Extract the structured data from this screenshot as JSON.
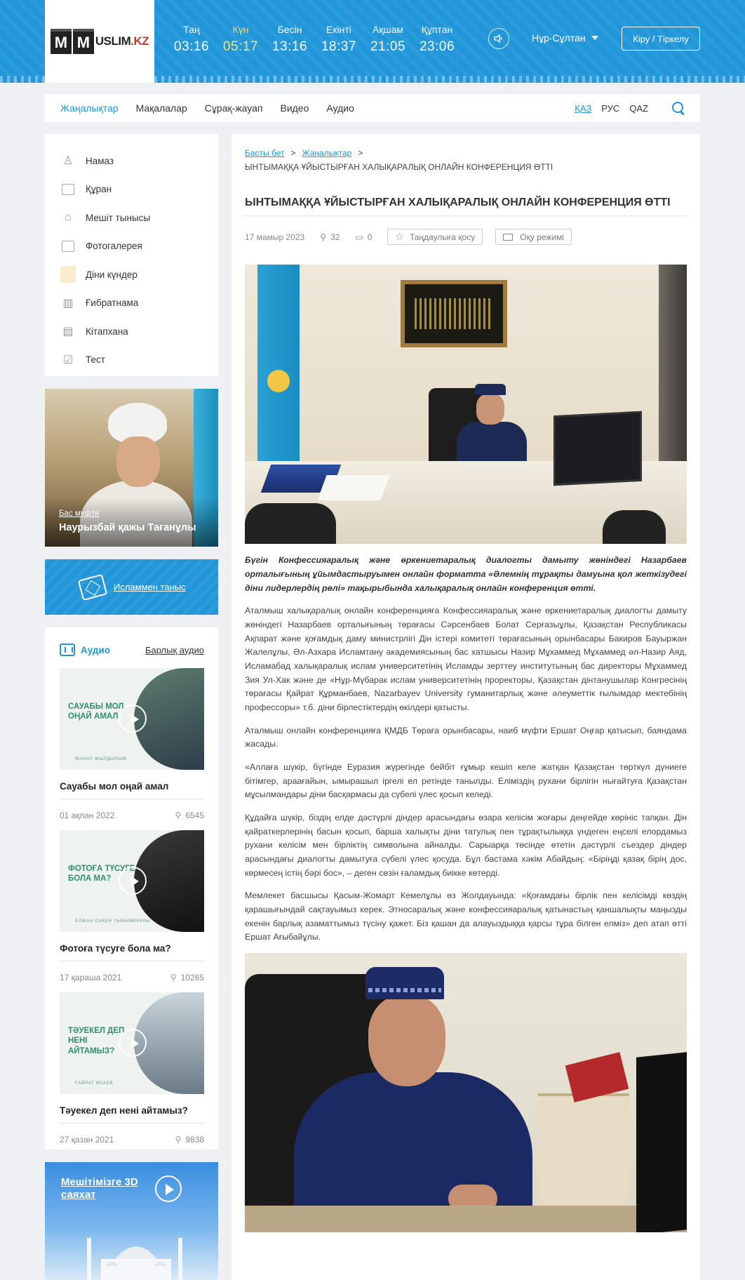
{
  "header": {
    "logo_text_a": "USLIM",
    "logo_text_b": ".KZ",
    "logo_m": "M",
    "prayers": [
      {
        "name": "Таң",
        "time": "03:16",
        "active": false
      },
      {
        "name": "Күн",
        "time": "05:17",
        "active": true
      },
      {
        "name": "Бесін",
        "time": "13:16",
        "active": false
      },
      {
        "name": "Екінті",
        "time": "18:37",
        "active": false
      },
      {
        "name": "Ақшам",
        "time": "21:05",
        "active": false
      },
      {
        "name": "Құптан",
        "time": "23:06",
        "active": false
      }
    ],
    "city": "Нұр-Сұлтан",
    "login_label": "Кіру / Тіркелу",
    "accent_color": "#2196d9"
  },
  "nav": {
    "items": [
      "Жаңалықтар",
      "Мақалалар",
      "Сұрақ-жауап",
      "Видео",
      "Аудио"
    ],
    "langs": [
      "ҚАЗ",
      "РУС",
      "QAZ"
    ]
  },
  "sidebar": {
    "menu": [
      {
        "label": "Намаз",
        "icon": "prayer-icon"
      },
      {
        "label": "Құран",
        "icon": "quran-icon"
      },
      {
        "label": "Мешіт тынысы",
        "icon": "mosque-icon"
      },
      {
        "label": "Фотогалерея",
        "icon": "gallery-icon"
      },
      {
        "label": "Діни күндер",
        "icon": "calendar-icon"
      },
      {
        "label": "Ғибратнама",
        "icon": "book-open-icon"
      },
      {
        "label": "Кітапхана",
        "icon": "library-icon"
      },
      {
        "label": "Тест",
        "icon": "checkbox-icon"
      }
    ],
    "mufti": {
      "role": "Бас мүфти",
      "name": "Наурызбай қажы Тағанұлы"
    },
    "islam_link": "Исламмен таныс",
    "audio": {
      "title": "Аудио",
      "all_label": "Барлық аудио",
      "items": [
        {
          "thumb_title": "САУАБЫ МОЛ ОҢАЙ АМАЛ",
          "thumb_sub": "ЖАНАТ ЖЫЛДЫРЫМ",
          "title": "Сауабы мол оңай амал",
          "date": "01 ақпан 2022",
          "views": "6545"
        },
        {
          "thumb_title": "ФОТОҒА ТҮСУГЕ БОЛА МА?",
          "thumb_sub": "ЕЛЖАН САКЕН ТЫНЫМЕКҰЛЫ",
          "title": "Фотоға түсуге бола ма?",
          "date": "17 қараша 2021",
          "views": "10265"
        },
        {
          "thumb_title": "ТӘУЕКЕЛ ДЕП НЕНІ АЙТАМЫЗ?",
          "thumb_sub": "ҒАЙРАТ ИСАЕВ",
          "title": "Тәуекел деп нені айтамыз?",
          "date": "27 қазан 2021",
          "views": "9838"
        }
      ]
    },
    "tour_title": "Мешітімізге 3D саяхат"
  },
  "article": {
    "crumbs": [
      "Басты бет",
      "Жаңалықтар"
    ],
    "crumb_current": "ЫНТЫМАҚҚА ҰЙЫСТЫРҒАН ХАЛЫҚАРАЛЫҚ ОНЛАЙН КОНФЕРЕНЦИЯ ӨТТІ",
    "title": "ЫНТЫМАҚҚА ҰЙЫСТЫРҒАН ХАЛЫҚАРАЛЫҚ ОНЛАЙН КОНФЕРЕНЦИЯ ӨТТІ",
    "date": "17 мамыр 2023",
    "views": "32",
    "comments": "0",
    "favorite_label": "Таңдаулыға қосу",
    "read_mode_label": "Оқу режимі",
    "lead": "Бүгін Конфессияаралық және өркениетаралық диалогты дамыту жөніндегі Назарбаев орталығының ұйымдастыруымен онлайн форматта «Әлемнің тұрақты дамуына қол жеткізудегі діни лидерлердің рөлі» тақырыбында халықаралық онлайн конференция өтті.",
    "paragraphs": [
      "Аталмыш халықаралық онлайн конференцияға Конфессияаралық және өркениетаралық диалогты дамыту жөніндегі Назарбаев орталығының төрағасы Сәрсенбаев Болат Серғазыұлы, Қазақстан Республикасы Ақпарат және қоғамдық даму министрлігі Дін істері комитеті төрағасының орынбасары Бакиров Бауыржан Жалелұлы, Әл-Азхара Исламтану академиясының бас хатшысы Назир Мұхаммед Мұхаммед әл-Назир Аяд, Исламабад халықаралық ислам университетінің Исламды зерттеу институтының бас директоры Мұхаммед Зия Ул-Хак және де «Нұр-Мүбарак ислам университетінің проректоры, Қазақстан дінтанушылар Конгресінің төрағасы Қайрат Құрманбаев, Nazarbayev University гуманитарлық және әлеуметтік ғылымдар мектебінің профессоры» т.б. діни бірлестіктердің өкілдері қатысты.",
      "Аталмыш онлайн конференцияға ҚМДБ Төраға орынбасары, наиб мүфти Ершат Оңғар қатысып, баяндама жасады.",
      "«Аллаға шүкір, бүгінде Еуразия жүрегінде бейбіт ғұмыр кешіп келе жатқан Қазақстан төрткүл дүниеге бітімгер, араағайын, ымырашыл іргелі ел ретінде танылды. Еліміздің рухани бірлігін нығайтуға Қазақстан мұсылмандары діни басқармасы да сүбелі үлес қосып келеді.",
      "Құдайға шүкір, біздің елде дәстүрлі діндер арасындағы өзара келісім жоғары деңгейде көрініс тапқан. Дін қайраткерлерінің басын қосып, барша халықты діни татулық пен тұрақтылыққа үндеген еңселі елордамыз рухани келісім мен бірліктің символына айналды. Сарыарқа төсінде өтетін дәстүрлі съездер діндер арасындағы диалогты дамытуға сүбелі үлес қосуда. Бұл бастама хәкім Абайдың: «Біріңді қазақ бірің дос, көрмесең істің бәрі бос», – деген сөзін ғаламдық биікке көтерді.",
      "Мемлекет басшысы Қасым-Жомарт Кемелұлы өз Жолдауында: «Қоғамдағы бірлік пен келісімді көздің қарашығындай сақтауымыз керек. Этносаралық және конфессияаралық қатынастың қаншалықты маңызды екенін барлық азаматтымыз түсіну қажет. Біз қашан да алауыздыққа қарсы тұра білген елміз» деп атап өтті Ершат Ағыбайұлы."
    ]
  }
}
